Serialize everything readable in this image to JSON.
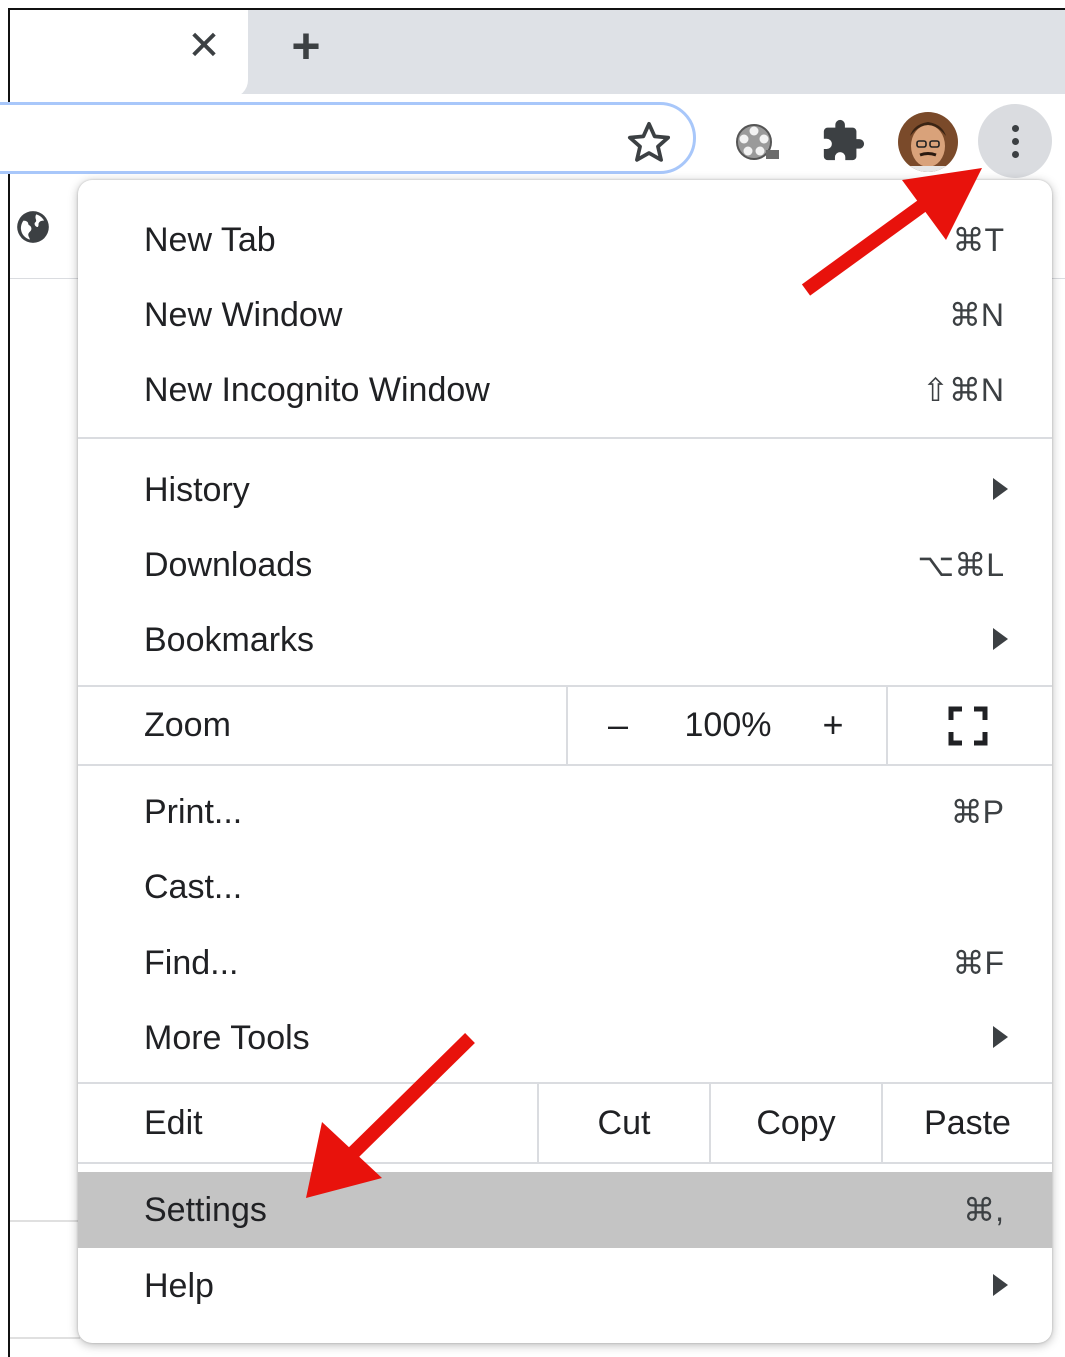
{
  "tab": {
    "close_glyph": "✕",
    "new_tab_glyph": "+"
  },
  "toolbar": {
    "icons": [
      "star-icon",
      "film-reel-extension-icon",
      "puzzle-extensions-icon",
      "profile-avatar",
      "more-vert-icon"
    ]
  },
  "menu": {
    "group1": [
      {
        "label": "New Tab",
        "shortcut": "⌘T"
      },
      {
        "label": "New Window",
        "shortcut": "⌘N"
      },
      {
        "label": "New Incognito Window",
        "shortcut": "⇧⌘N"
      }
    ],
    "group2": [
      {
        "label": "History",
        "shortcut": ""
      },
      {
        "label": "Downloads",
        "shortcut": "⌥⌘L"
      },
      {
        "label": "Bookmarks",
        "shortcut": ""
      }
    ],
    "zoom": {
      "label": "Zoom",
      "minus": "–",
      "value": "100%",
      "plus": "+",
      "fullscreen_icon": "fullscreen-icon"
    },
    "group3": [
      {
        "label": "Print...",
        "shortcut": "⌘P"
      },
      {
        "label": "Cast...",
        "shortcut": ""
      },
      {
        "label": "Find...",
        "shortcut": "⌘F"
      },
      {
        "label": "More Tools",
        "shortcut": ""
      }
    ],
    "edit": {
      "label": "Edit",
      "cut": "Cut",
      "copy": "Copy",
      "paste": "Paste"
    },
    "group4": [
      {
        "label": "Settings",
        "shortcut": "⌘,",
        "highlighted": true
      },
      {
        "label": "Help",
        "shortcut": ""
      }
    ]
  },
  "annotations": {
    "arrow_color": "#e8120c"
  }
}
